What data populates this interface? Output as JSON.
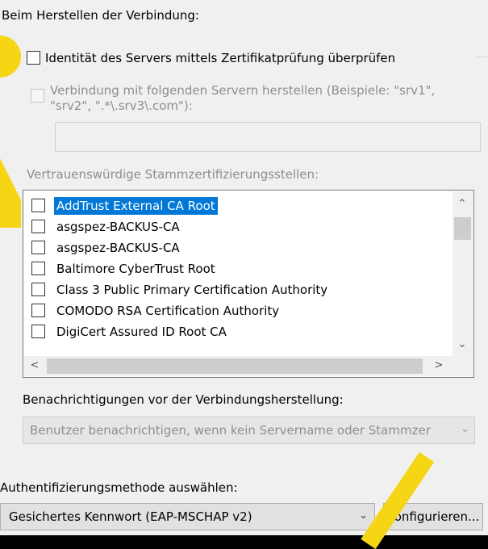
{
  "section": {
    "connect_label": "Beim Herstellen der Verbindung:",
    "verify_identity_label": "Identität des Servers mittels Zertifikatprüfung überprüfen",
    "connect_servers_label_line1": "Verbindung mit folgenden Servern herstellen (Beispiele: \"srv1\",",
    "connect_servers_label_line2": "\"srv2\", \".*\\.srv3\\.com\"):",
    "server_names_value": ""
  },
  "trusted_ca": {
    "label": "Vertrauenswürdige Stammzertifizierungsstellen:",
    "items": [
      {
        "name": "AddTrust External CA Root",
        "selected": true,
        "checked": false
      },
      {
        "name": "asgspez-BACKUS-CA",
        "selected": false,
        "checked": false
      },
      {
        "name": "asgspez-BACKUS-CA",
        "selected": false,
        "checked": false
      },
      {
        "name": "Baltimore CyberTrust Root",
        "selected": false,
        "checked": false
      },
      {
        "name": "Class 3 Public Primary Certification Authority",
        "selected": false,
        "checked": false
      },
      {
        "name": "COMODO RSA Certification Authority",
        "selected": false,
        "checked": false
      },
      {
        "name": "DigiCert Assured ID Root CA",
        "selected": false,
        "checked": false
      }
    ]
  },
  "notifications": {
    "label": "Benachrichtigungen vor der Verbindungsherstellung:",
    "selected_value": "Benutzer benachrichtigen, wenn kein Servername oder Stammzer"
  },
  "authentication": {
    "label": "Authentifizierungsmethode auswählen:",
    "selected_value": "Gesichertes Kennwort (EAP-MSCHAP v2)",
    "configure_label": "Konfigurieren..."
  },
  "colors": {
    "selection": "#0078d7",
    "marker": "#f5d514",
    "background": "#f0f0f0"
  }
}
